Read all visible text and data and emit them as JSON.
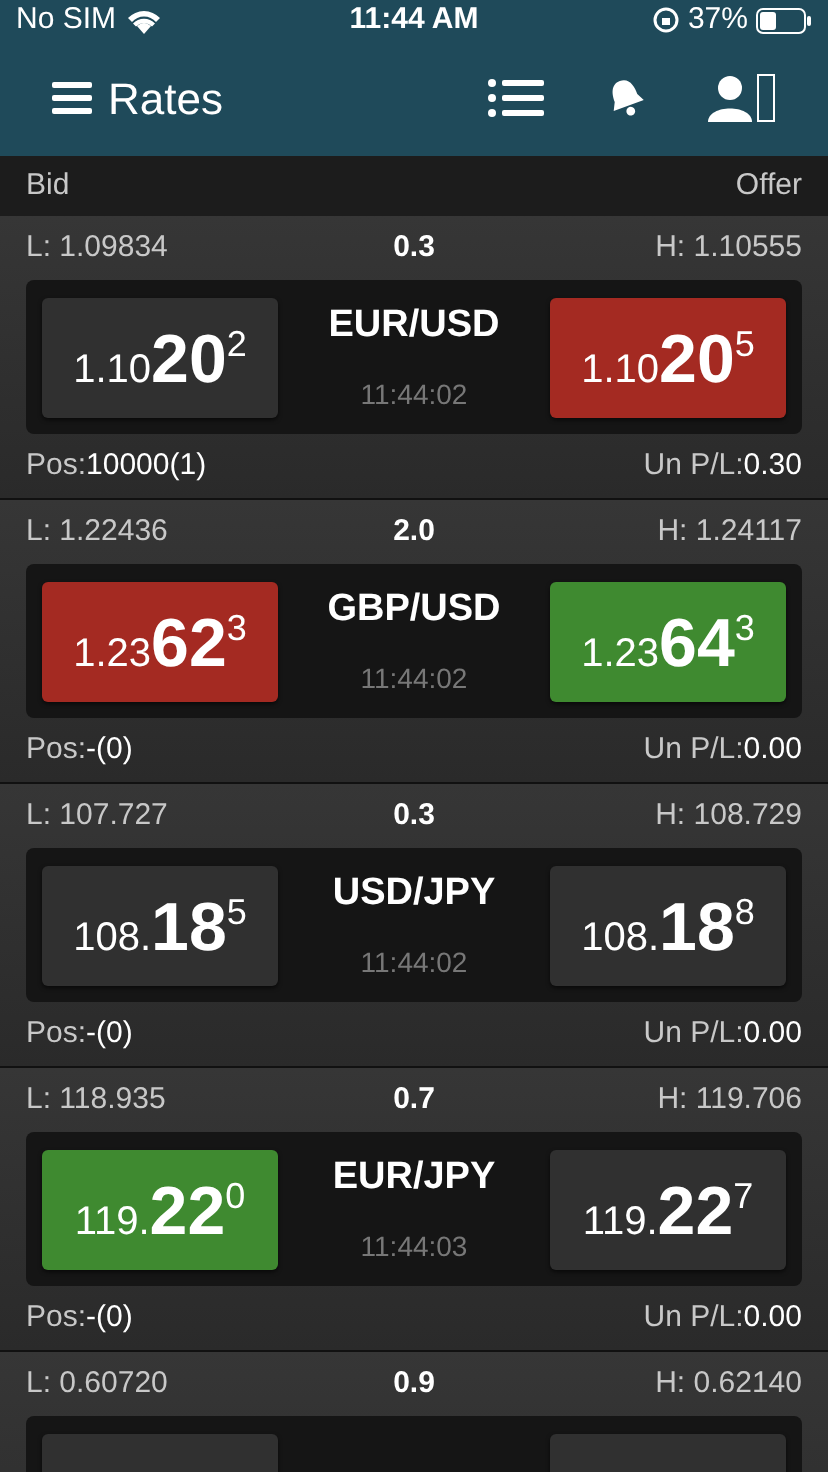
{
  "status_bar": {
    "carrier": "No SIM",
    "time": "11:44 AM",
    "battery": "37%"
  },
  "header": {
    "title": "Rates"
  },
  "columns": {
    "left": "Bid",
    "right": "Offer"
  },
  "rates": [
    {
      "low": "L: 1.09834",
      "spread": "0.3",
      "high": "H: 1.10555",
      "pair": "EUR/USD",
      "time": "11:44:02",
      "bid": {
        "prefix": "1.10",
        "big": "20",
        "pip": "2",
        "color": "#303030"
      },
      "offer": {
        "prefix": "1.10",
        "big": "20",
        "pip": "5",
        "color": "#a42a22"
      },
      "pos_label": "Pos:",
      "pos": "10000(1)",
      "pl_label": "Un P/L:",
      "pl": "0.30"
    },
    {
      "low": "L: 1.22436",
      "spread": "2.0",
      "high": "H: 1.24117",
      "pair": "GBP/USD",
      "time": "11:44:02",
      "bid": {
        "prefix": "1.23",
        "big": "62",
        "pip": "3",
        "color": "#a42a22"
      },
      "offer": {
        "prefix": "1.23",
        "big": "64",
        "pip": "3",
        "color": "#3f8a30"
      },
      "pos_label": "Pos:",
      "pos": "-(0)",
      "pl_label": "Un P/L:",
      "pl": "0.00"
    },
    {
      "low": "L: 107.727",
      "spread": "0.3",
      "high": "H: 108.729",
      "pair": "USD/JPY",
      "time": "11:44:02",
      "bid": {
        "prefix": "108.",
        "big": "18",
        "pip": "5",
        "color": "#303030"
      },
      "offer": {
        "prefix": "108.",
        "big": "18",
        "pip": "8",
        "color": "#303030"
      },
      "pos_label": "Pos:",
      "pos": "-(0)",
      "pl_label": "Un P/L:",
      "pl": "0.00"
    },
    {
      "low": "L: 118.935",
      "spread": "0.7",
      "high": "H: 119.706",
      "pair": "EUR/JPY",
      "time": "11:44:03",
      "bid": {
        "prefix": "119.",
        "big": "22",
        "pip": "0",
        "color": "#3f8a30"
      },
      "offer": {
        "prefix": "119.",
        "big": "22",
        "pip": "7",
        "color": "#303030"
      },
      "pos_label": "Pos:",
      "pos": "-(0)",
      "pl_label": "Un P/L:",
      "pl": "0.00"
    },
    {
      "low": "L: 0.60720",
      "spread": "0.9",
      "high": "H: 0.62140",
      "bid": {
        "color": "#303030"
      },
      "offer": {
        "color": "#303030"
      }
    }
  ]
}
